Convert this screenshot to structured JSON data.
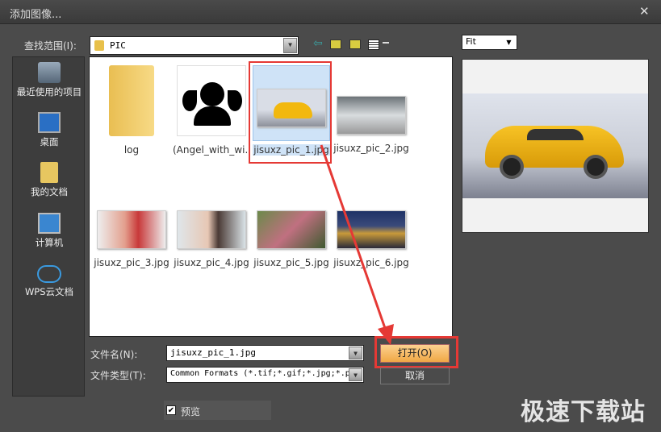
{
  "window": {
    "title": "添加图像...",
    "close": "✕"
  },
  "lookin": {
    "label": "查找范围(I):",
    "value": "PIC"
  },
  "sidebar": {
    "items": [
      {
        "label": "最近使用的项目"
      },
      {
        "label": "桌面"
      },
      {
        "label": "我的文档"
      },
      {
        "label": "计算机"
      },
      {
        "label": "WPS云文档"
      }
    ]
  },
  "files": [
    {
      "name": "log",
      "kind": "folder"
    },
    {
      "name": "(Angel_with_wi...",
      "kind": "angel"
    },
    {
      "name": "jisuxz_pic_1.jpg",
      "kind": "car-yellow",
      "selected": true
    },
    {
      "name": "jisuxz_pic_2.jpg",
      "kind": "car-white"
    },
    {
      "name": "jisuxz_pic_3.jpg",
      "kind": "portrait-red"
    },
    {
      "name": "jisuxz_pic_4.jpg",
      "kind": "portrait"
    },
    {
      "name": "jisuxz_pic_5.jpg",
      "kind": "aerial"
    },
    {
      "name": "jisuxz_pic_6.jpg",
      "kind": "night-city"
    }
  ],
  "filename": {
    "label": "文件名(N):",
    "value": "jisuxz_pic_1.jpg"
  },
  "filetype": {
    "label": "文件类型(T):",
    "value": "Common Formats (*.tif;*.gif;*.jpg;*.p"
  },
  "buttons": {
    "open": "打开(O)",
    "cancel": "取消"
  },
  "preview_check": {
    "label": "预览",
    "checked": true
  },
  "zoom": {
    "value": "Fit"
  },
  "watermark": "极速下载站",
  "colors": {
    "highlight": "#e53935",
    "open_button": "#f0a844"
  }
}
